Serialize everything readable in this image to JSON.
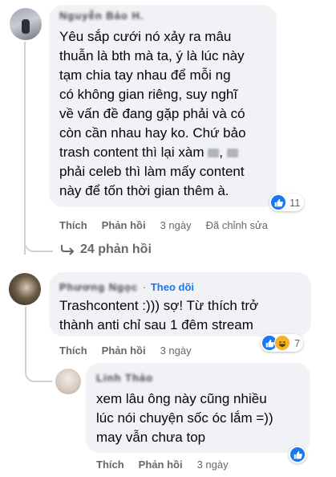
{
  "comment1": {
    "author": "Nguyễn Bảo H.",
    "lines": [
      "Yêu sắp cưới nó xảy ra mâu",
      "thuẫn là bth mà ta, ý là lúc này",
      "tạm chia tay nhau để mỗi ng",
      "có không gian riêng, suy nghĩ",
      "về vấn đề đang gặp phải và có",
      "còn cần nhau hay ko. Chứ bảo",
      "trash content thì lại xàm",
      "phải celeb thì làm mấy content",
      "này để tốn thời gian thêm à."
    ],
    "reaction_count": "11",
    "actions": {
      "like": "Thích",
      "reply": "Phản hồi",
      "time": "3 ngày",
      "edited": "Đã chỉnh sửa"
    }
  },
  "replies_toggle": "24 phản hồi",
  "comment2": {
    "author": "Phương Ngọc",
    "follow": "Theo dõi",
    "follow_sep": "·",
    "lines": [
      "Trashcontent :))) sợ! Từ thích trở",
      "thành anti chỉ sau 1 đêm stream"
    ],
    "reaction_count": "7",
    "actions": {
      "like": "Thích",
      "reply": "Phản hồi",
      "time": "3 ngày"
    }
  },
  "comment3": {
    "author": "Linh Thảo",
    "lines": [
      "xem lâu ông này cũng nhiều",
      "lúc nói chuyện sốc óc lắm =))",
      "may vẫn chưa top"
    ],
    "actions": {
      "like": "Thích",
      "reply": "Phản hồi",
      "time": "3 ngày"
    }
  },
  "colors": {
    "bubble": "#f0f2f5",
    "meta": "#65676b",
    "link": "#1877f2",
    "like": "#1877f2",
    "haha": "#f7b125"
  },
  "icons": [
    "like-icon",
    "haha-icon",
    "reply-arrow-icon"
  ]
}
